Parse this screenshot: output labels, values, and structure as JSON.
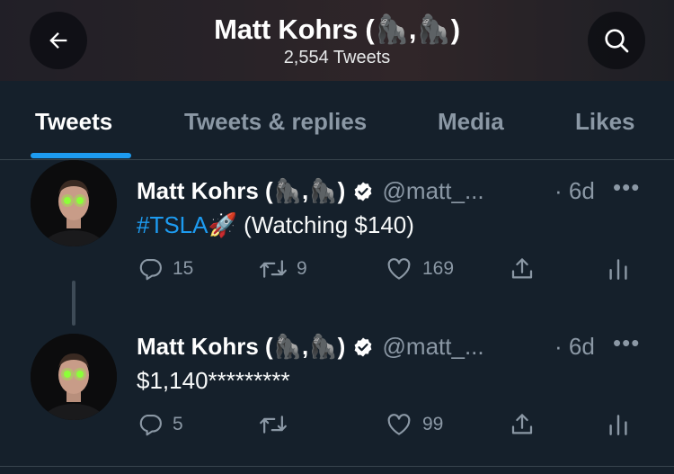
{
  "header": {
    "title": "Matt Kohrs (🦍,🦍)",
    "subtitle": "2,554 Tweets"
  },
  "tabs": [
    {
      "label": "Tweets",
      "active": true
    },
    {
      "label": "Tweets & replies",
      "active": false
    },
    {
      "label": "Media",
      "active": false
    },
    {
      "label": "Likes",
      "active": false
    }
  ],
  "tweets": [
    {
      "name": "Matt Kohrs (🦍,🦍)",
      "handle": "@matt_...",
      "time": "· 6d",
      "hashtag": "#TSLA",
      "emoji": "🚀",
      "text": "(Watching $140)",
      "replies": "15",
      "retweets": "9",
      "likes": "169"
    },
    {
      "name": "Matt Kohrs (🦍,🦍)",
      "handle": "@matt_...",
      "time": "· 6d",
      "text": "$1,140*********",
      "replies": "5",
      "retweets": "",
      "likes": "99"
    }
  ],
  "colors": {
    "background": "#15202b",
    "accent": "#1d9bf0",
    "muted": "#8b98a5",
    "divider": "#38444d"
  },
  "icons": [
    "back-arrow-icon",
    "search-icon",
    "verified-badge-icon",
    "more-icon",
    "reply-icon",
    "retweet-icon",
    "like-icon",
    "share-icon",
    "analytics-icon"
  ]
}
